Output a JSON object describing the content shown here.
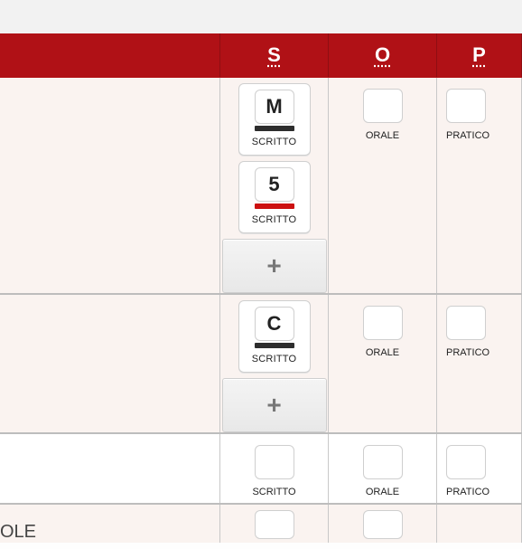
{
  "header": {
    "col_s": "S",
    "col_o": "O",
    "col_p": "P"
  },
  "labels": {
    "scritto": "SCRITTO",
    "orale": "ORALE",
    "pratico": "PRATICO",
    "plus": "+"
  },
  "rows": [
    {
      "subject": "",
      "scritto_grades": [
        {
          "value": "M",
          "bar": "dark"
        },
        {
          "value": "5",
          "bar": "red"
        }
      ],
      "has_add": true
    },
    {
      "subject": "",
      "scritto_grades": [
        {
          "value": "C",
          "bar": "dark"
        }
      ],
      "has_add": true
    },
    {
      "subject": "",
      "scritto_grades": [],
      "has_add": false
    },
    {
      "subject": "OLE",
      "scritto_grades": [],
      "has_add": false
    }
  ]
}
